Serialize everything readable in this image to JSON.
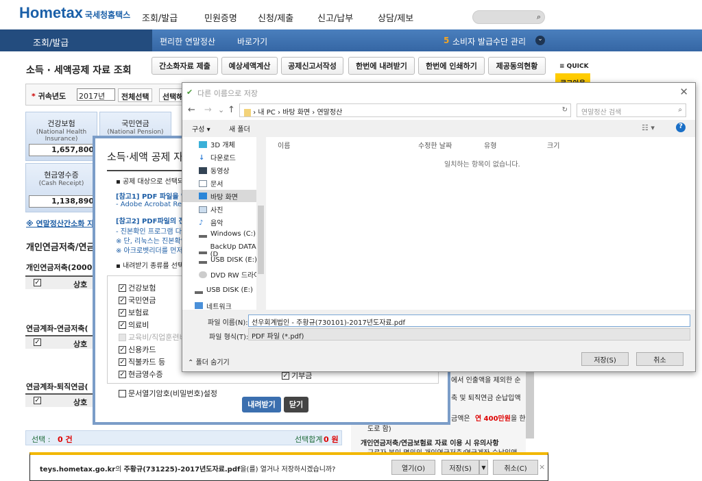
{
  "header": {
    "logo": "Hometax",
    "logo_sub": "국세청홈택스",
    "menu": [
      "조회/발급",
      "민원증명",
      "신청/제출",
      "신고/납부",
      "상담/제보"
    ]
  },
  "nav": {
    "menu": "조회/발급",
    "crumb1": "편리한 연말정산",
    "crumb2": "바로가기",
    "notice_num": "5",
    "notice": "소비자 발급수단 관리"
  },
  "page": {
    "title": "소득 · 세액공제 자료 조회",
    "buttons": [
      "간소화자료 제출",
      "예상세액계산",
      "공제신고서작성",
      "한번에 내려받기",
      "한번에 인쇄하기",
      "제공동의현황"
    ],
    "quick": "≡ QUICK",
    "logout": "로그아웃",
    "year_label": "귀속년도",
    "year": "2017년",
    "select_all": "전체선택",
    "select_btn": "선택해",
    "cards": [
      {
        "name": "건강보험",
        "en": "(National Health Insurance)",
        "value": "1,657,800"
      },
      {
        "name": "국민연금",
        "en": "(National Pension)",
        "value": ""
      },
      {
        "name": "현금영수증",
        "en": "(Cash Receipt)",
        "value": "1,138,890"
      }
    ],
    "link": "※ 연말정산간소화 자",
    "section": "개인연금저축/연금",
    "sub1": "개인연금저축(2000",
    "sub2": "연금계좌-연금저축(",
    "sub3": "연금계좌-퇴직연금(",
    "col": "상호",
    "selected": "선택 :",
    "selected_count": "0 건",
    "sum_label": "선택합계",
    "sum_value": "0 원",
    "right_lines": [
      "에서 인출액을 제외한 순",
      "축 및 퇴직연금 순납입액",
      "금액은",
      "연 400만원",
      "을 한",
      "도로 함)",
      "개인연금저축/연금보험료 자료 이용 시 유의사항",
      "근로자 본인 명의의 개인연금저축/연금계좌 순납입액"
    ]
  },
  "modal": {
    "title": "소득·세액 공제 자료",
    "line1": "공제 대상으로 선택되",
    "ref1": "[참고1] PDF 파일을 열",
    "ref1b": "- Adobe Acrobat Rea",
    "ref2": "[참고2] PDF파일의 진",
    "ref2a": "- 진본확인 프로그램 다",
    "ref2b": "※ 단, 리눅스는 진본확인",
    "ref2c": "※ 아크로벳리더를 먼저",
    "line2": "내려받기 종류를 선택",
    "items": [
      {
        "label": "건강보험",
        "checked": true
      },
      {
        "label": "국민연금",
        "checked": true
      },
      {
        "label": "보험료",
        "checked": true
      },
      {
        "label": "의료비",
        "checked": true
      },
      {
        "label": "교육비/직업훈련비",
        "checked": false,
        "disabled": true
      },
      {
        "label": "신용카드",
        "checked": true
      },
      {
        "label": "직불카드 등",
        "checked": true
      },
      {
        "label": "현금영수증",
        "checked": true
      }
    ],
    "extra_item": "기부금",
    "password": "문서열기암호(비밀번호)설정",
    "download": "내려받기",
    "close": "닫기"
  },
  "dialog": {
    "title": "다른 이름으로 저장",
    "path": [
      "내 PC",
      "바탕 화면",
      "연말정산"
    ],
    "search_placeholder": "연말정산 검색",
    "organize": "구성 ▾",
    "new_folder": "새 폴더",
    "tree": [
      "3D 개체",
      "다운로드",
      "동영상",
      "문서",
      "바탕 화면",
      "사진",
      "음악",
      "Windows (C:)",
      "BackUp DATA (D",
      "USB DISK (E:)",
      "DVD RW 드라이",
      "USB DISK (E:)",
      "네트워크"
    ],
    "columns": [
      "이름",
      "수정한 날짜",
      "유형",
      "크기"
    ],
    "empty": "일치하는 항목이 없습니다.",
    "filename_label": "파일 이름(N):",
    "filename": "선우회계법인 - 주황규(730101)-2017년도자료.pdf",
    "filetype_label": "파일 형식(T):",
    "filetype": "PDF 파일 (*.pdf)",
    "hide_folders": "폴더 숨기기",
    "save": "저장(S)",
    "cancel": "취소"
  },
  "download_bar": {
    "site": "teys.hometax.go.kr",
    "mid": "의 ",
    "file": "주황규(731225)-2017년도자료.pdf",
    "suffix": "을(를) 열거나 저장하시겠습니까?",
    "open": "열기(O)",
    "save": "저장(S)",
    "cancel": "취소(C)"
  }
}
